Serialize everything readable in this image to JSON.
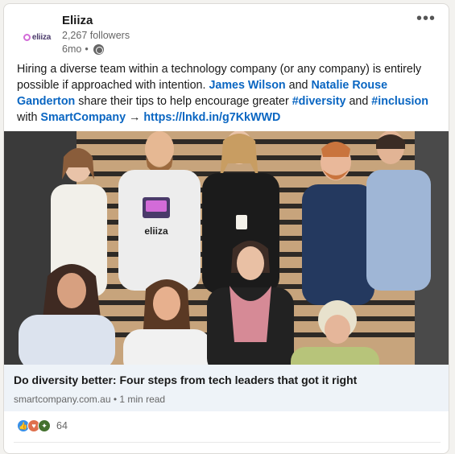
{
  "post": {
    "author_name": "Eliiza",
    "author_logo_text": "eliiza",
    "followers": "2,267 followers",
    "time": "6mo",
    "visibility_icon": "globe-icon",
    "more_icon": "•••",
    "text_1": "Hiring a diverse team within a technology company (or any company) is entirely possible if approached with intention. ",
    "mention_1": "James Wilson",
    "text_2": " and ",
    "mention_2": "Natalie Rouse Ganderton",
    "text_3": " share their tips to help encourage greater ",
    "hashtag_1": "#diversity",
    "text_4": " and ",
    "hashtag_2": "#inclusion",
    "text_5": " with ",
    "mention_3": "SmartCompany",
    "arrow": " → ",
    "url": "https://lnkd.in/g7KkWWD"
  },
  "image": {
    "shirt_logo_text": "eliiza"
  },
  "preview": {
    "title": "Do diversity better: Four steps from tech leaders that got it right",
    "source": "smartcompany.com.au",
    "read_time": "1 min read"
  },
  "reactions": {
    "count": "64",
    "icons": [
      "like-icon",
      "love-icon",
      "insightful-icon"
    ]
  },
  "colors": {
    "link": "#0a66c2",
    "preview_bg": "#eef3f8",
    "like": "#378fe9",
    "love": "#df704d",
    "insightful": "#44712e"
  }
}
